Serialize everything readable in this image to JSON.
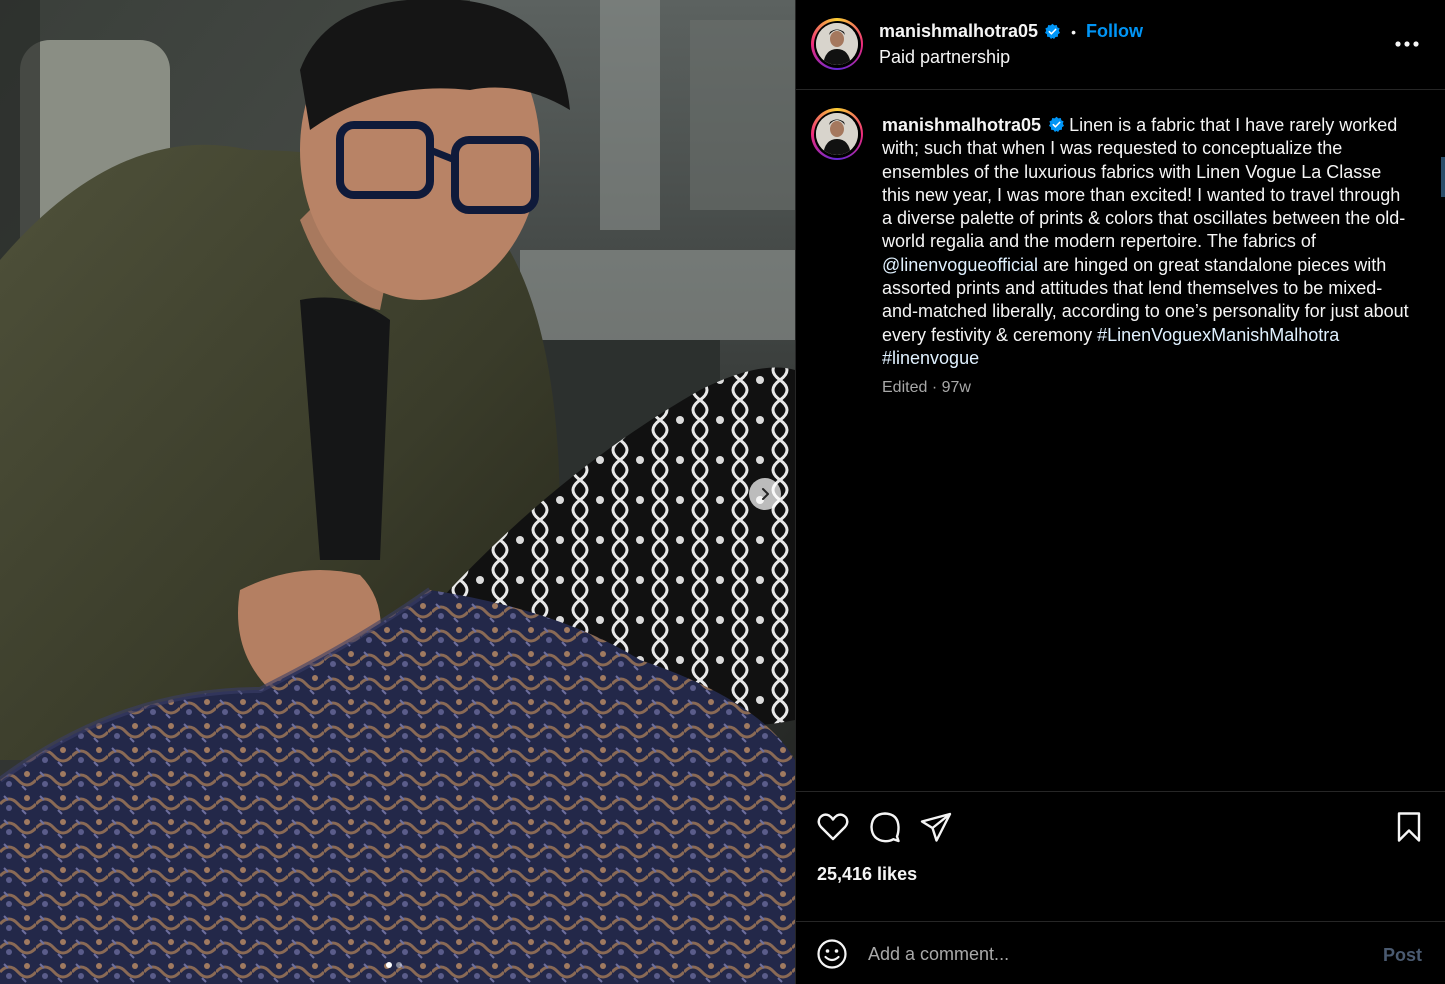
{
  "post": {
    "author": "manishmalhotra05",
    "follow_label": "Follow",
    "separator": "•",
    "subtitle": "Paid partnership",
    "verified": true
  },
  "media": {
    "slide_count": 2,
    "active_slide": 1,
    "next_icon": "chevron-right-icon"
  },
  "caption": {
    "author": "manishmalhotra05",
    "text_1": "Linen is a fabric that I have rarely worked with; such that when I was requested to conceptualize the ensembles of the luxurious fabrics with Linen Vogue La Classe this new year, I was more than excited! I wanted to travel through a diverse palette of prints & colors that oscillates between the old-world regalia and the modern repertoire. The fabrics of ",
    "mention": "@linenvogueofficial",
    "text_2": " are hinged on great standalone pieces with assorted prints and attitudes that lend themselves to be mixed-and-matched liberally, according to one’s personality for just about every festivity & ceremony ",
    "hashtag_1": "#LinenVoguexManishMalhotra",
    "hashtag_2": "#linenvogue",
    "meta": "Edited · 97w"
  },
  "actions": {
    "like_icon": "heart-icon",
    "comment_icon": "comment-icon",
    "share_icon": "share-icon",
    "save_icon": "bookmark-icon",
    "likes": "25,416 likes"
  },
  "add_comment": {
    "emoji_icon": "smiley-icon",
    "placeholder": "Add a comment...",
    "post_label": "Post"
  },
  "colors": {
    "background": "#000000",
    "accent": "#0095f6",
    "verified": "#0095f6",
    "muted_text": "#a8a8a8",
    "post_disabled": "#4a5a70"
  }
}
